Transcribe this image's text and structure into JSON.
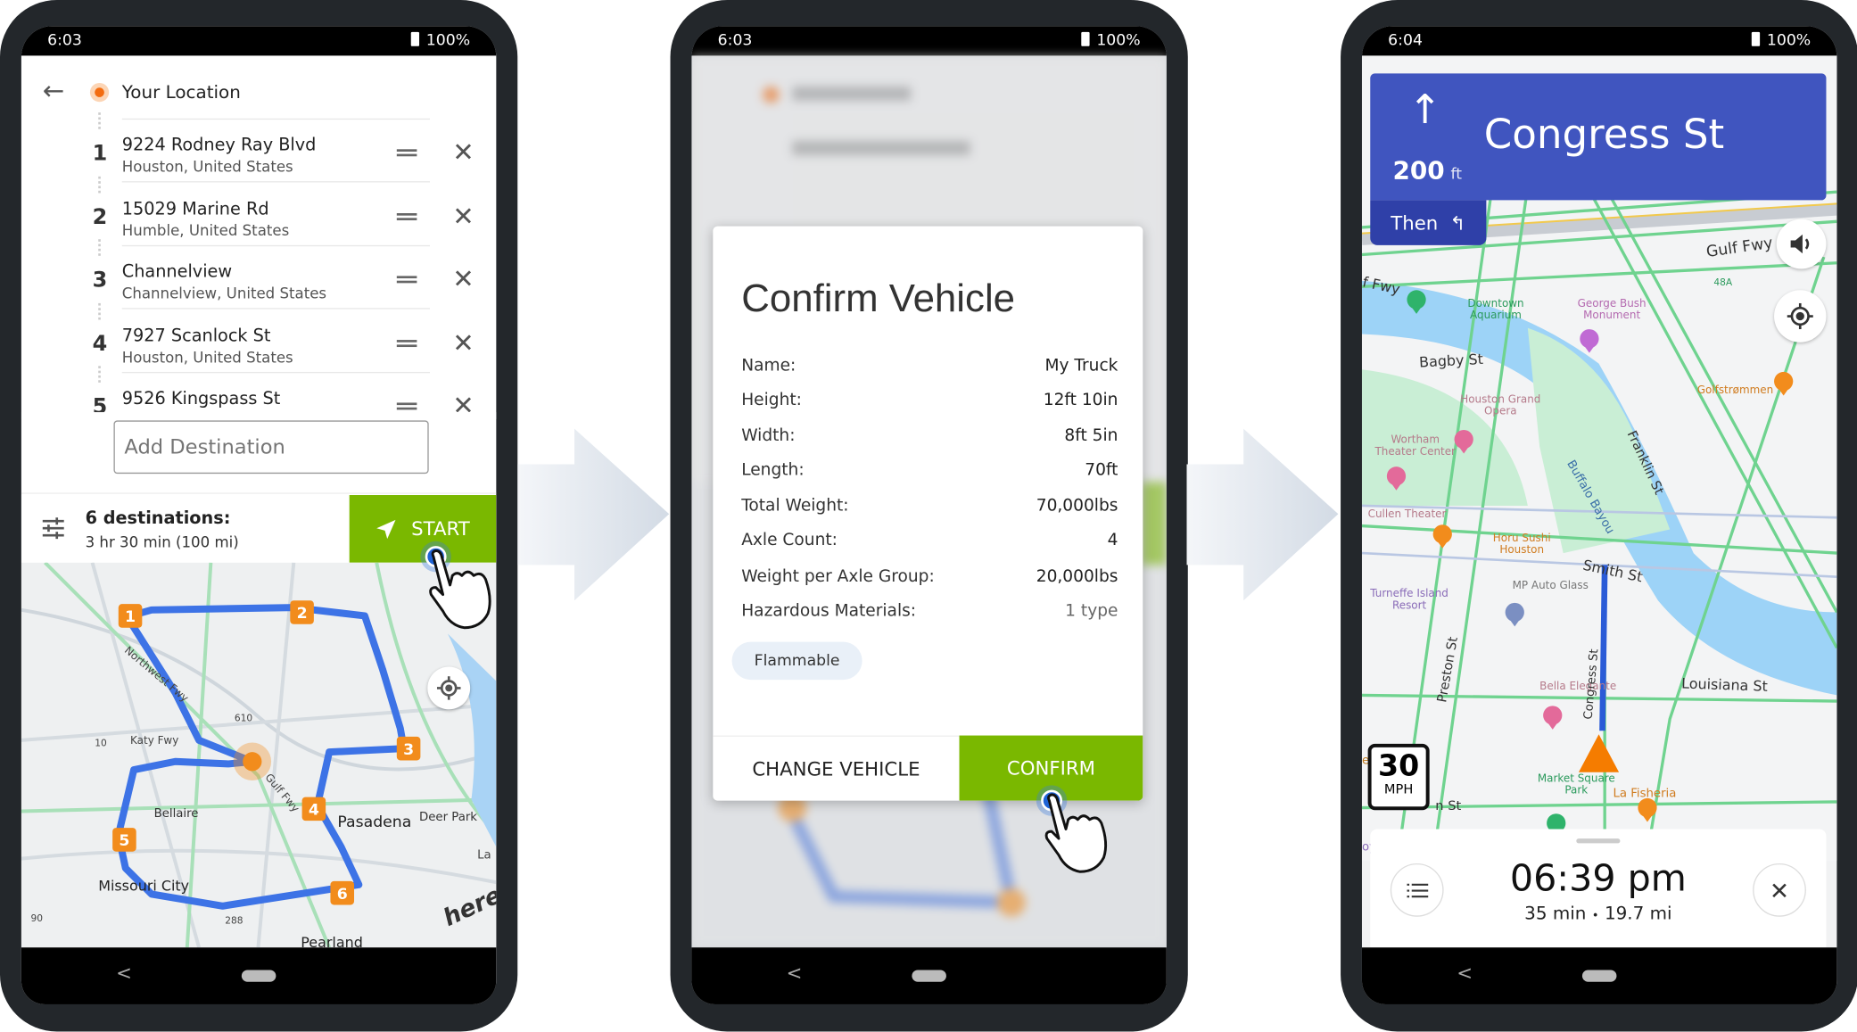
{
  "phone1": {
    "status": {
      "time": "6:03",
      "battery": "100%"
    },
    "origin_label": "Your Location",
    "stops": [
      {
        "num": "1",
        "title": "9224 Rodney Ray Blvd",
        "subtitle": "Houston, United States"
      },
      {
        "num": "2",
        "title": "15029 Marine Rd",
        "subtitle": "Humble, United States"
      },
      {
        "num": "3",
        "title": "Channelview",
        "subtitle": "Channelview, United States"
      },
      {
        "num": "4",
        "title": "7927 Scanlock St",
        "subtitle": "Houston, United States"
      },
      {
        "num": "5",
        "title": "9526 Kingspass St",
        "subtitle": ""
      }
    ],
    "add_destination_placeholder": "Add Destination",
    "summary_title": "6 destinations:",
    "summary_detail": "3 hr 30 min (100 mi)",
    "start_label": "START",
    "map": {
      "markers": [
        "1",
        "2",
        "3",
        "4",
        "5",
        "6"
      ],
      "labels": [
        "Pasadena",
        "Missouri City",
        "Bellaire",
        "Pearland",
        "Deer Park",
        "Katy Fwy",
        "Northwest Fwy",
        "Gulf Fwy",
        "La",
        "610",
        "10",
        "288",
        "90"
      ],
      "logo": "here"
    }
  },
  "phone2": {
    "status": {
      "time": "6:03",
      "battery": "100%"
    },
    "dialog": {
      "title": "Confirm Vehicle",
      "rows": [
        {
          "label": "Name:",
          "value": "My Truck"
        },
        {
          "label": "Height:",
          "value": "12ft 10in"
        },
        {
          "label": "Width:",
          "value": "8ft 5in"
        },
        {
          "label": "Length:",
          "value": "70ft"
        },
        {
          "label": "Total Weight:",
          "value": "70,000lbs"
        },
        {
          "label": "Axle Count:",
          "value": "4"
        },
        {
          "label": "Weight per Axle Group:",
          "value": "20,000lbs"
        },
        {
          "label": "Hazardous Materials:",
          "value": "1 type"
        }
      ],
      "chip": "Flammable",
      "change_label": "CHANGE VEHICLE",
      "confirm_label": "CONFIRM"
    }
  },
  "phone3": {
    "status": {
      "time": "6:04",
      "battery": "100%"
    },
    "instruction": {
      "distance": "200",
      "unit": "ft",
      "street": "Congress St",
      "then_label": "Then"
    },
    "speed_limit": {
      "value": "30",
      "unit": "MPH"
    },
    "eta": {
      "time": "06:39 pm",
      "duration": "35 min",
      "separator": "•",
      "distance": "19.7 mi"
    },
    "map": {
      "labels": [
        "Gulf Fwy",
        "f Fwy",
        "48A",
        "Downtown Aquarium",
        "George Bush Monument",
        "Bagby St",
        "Golfstrømmen",
        "Houston Grand Opera",
        "Wortham Theater Center",
        "Cullen Theater",
        "Horu Sushi Houston",
        "Buffalo Bayou",
        "Franklin St",
        "Smith St",
        "Turneffe Island Resort",
        "MP Auto Glass",
        "Louisiana St",
        "Bella Elegante",
        "Preston St",
        "Congress St",
        "Market Square Park",
        "La Fisheria",
        "erim",
        "n St",
        "oyride"
      ]
    }
  },
  "colors": {
    "green": "#7ab800",
    "blue_banner": "#4055bf",
    "then_tab": "#2f40a8",
    "route": "#3d73e6",
    "marker": "#f28c1c",
    "frame": "#23272b"
  }
}
